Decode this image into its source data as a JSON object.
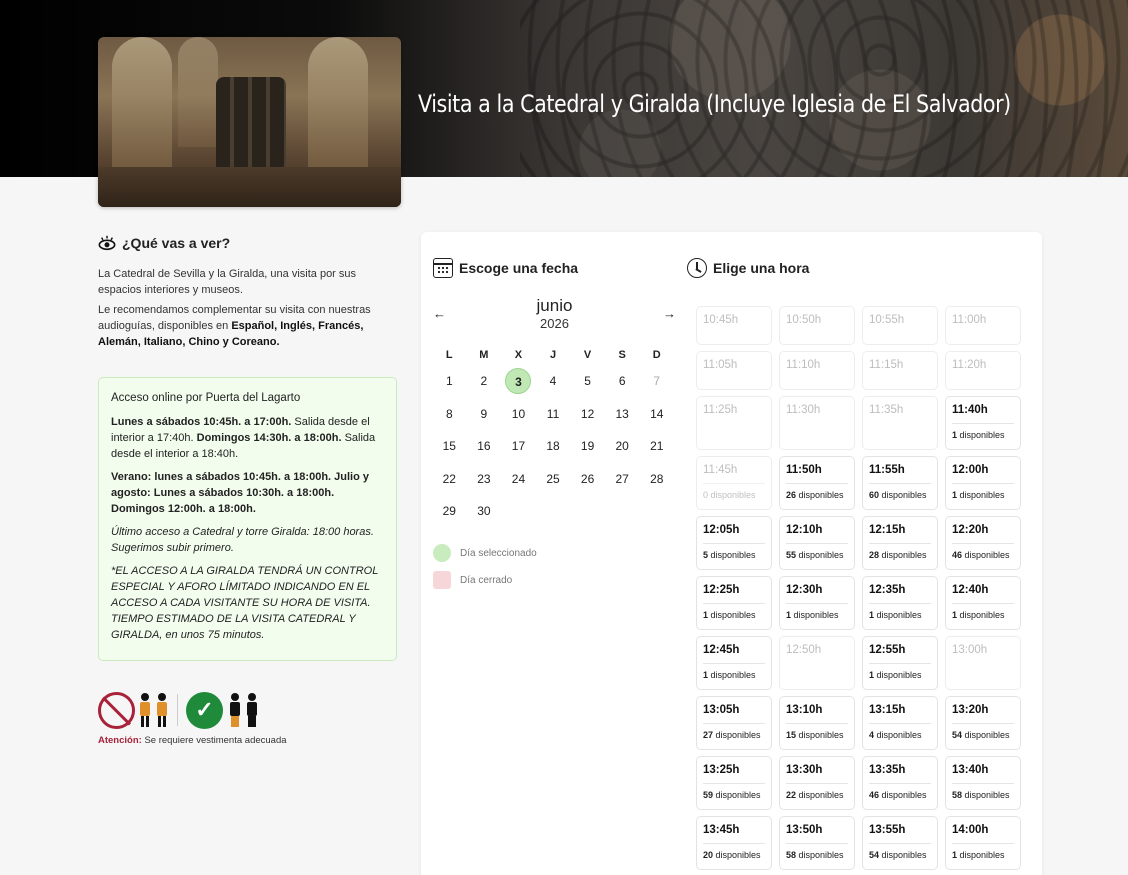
{
  "hero": {
    "title": "Visita a la Catedral y Giralda (Incluye Iglesia de El Salvador)"
  },
  "what_you_see": {
    "heading": "¿Qué vas a ver?",
    "p1": "La Catedral de Sevilla y la Giralda, una visita por sus espacios interiores y museos.",
    "p2_prefix": "Le recomendamos complementar su visita con nuestras audioguías, disponibles en ",
    "p2_langs": "Español, Inglés, Francés, Alemán, Italiano, Chino y Coreano."
  },
  "info_box": {
    "title": "Acceso online por Puerta del Lagarto",
    "hours_a": "Lunes a sábados  10:45h. a 17:00h.",
    "hours_a_rest": " Salida desde el interior a 17:40h. ",
    "hours_b": "Domingos  14:30h. a 18:00h.",
    "hours_b_rest": " Salida desde el interior a 18:40h.",
    "summer": "Verano: lunes a sábados 10:45h. a 18:00h. Julio y agosto: Lunes a sábados 10:30h. a 18:00h. Domingos 12:00h. a 18:00h.",
    "last_access": "Último acceso a Catedral y torre Giralda: 18:00 horas. Sugerimos subir primero.",
    "notice": "*EL ACCESO A LA GIRALDA TENDRÁ UN CONTROL ESPECIAL Y AFORO LÍMITADO INDICANDO EN EL ACCESO A CADA VISITANTE SU HORA DE VISITA. TIEMPO ESTIMADO DE LA VISITA CATEDRAL Y GIRALDA, en unos 75 minutos."
  },
  "dress": {
    "label": "Atención:",
    "text": " Se requiere vestimenta adecuada"
  },
  "date_section": {
    "heading": "Escoge una fecha",
    "month": "junio",
    "year": "2026",
    "prev": "←",
    "next": "→",
    "weekdays": [
      "L",
      "M",
      "X",
      "J",
      "V",
      "S",
      "D"
    ],
    "weeks": [
      [
        "1",
        "2",
        "3",
        "4",
        "5",
        "6",
        "7"
      ],
      [
        "8",
        "9",
        "10",
        "11",
        "12",
        "13",
        "14"
      ],
      [
        "15",
        "16",
        "17",
        "18",
        "19",
        "20",
        "21"
      ],
      [
        "22",
        "23",
        "24",
        "25",
        "26",
        "27",
        "28"
      ],
      [
        "29",
        "30",
        "",
        "",
        "",
        "",
        ""
      ]
    ],
    "selected": "3",
    "disabled": [
      "7"
    ],
    "legend_selected": "Día seleccionado",
    "legend_closed": "Día cerrado"
  },
  "time_section": {
    "heading": "Elige una hora",
    "unit": "disponibles",
    "slots": [
      {
        "time": "10:45h",
        "available": null
      },
      {
        "time": "10:50h",
        "available": null
      },
      {
        "time": "10:55h",
        "available": null
      },
      {
        "time": "11:00h",
        "available": null
      },
      {
        "time": "11:05h",
        "available": null
      },
      {
        "time": "11:10h",
        "available": null
      },
      {
        "time": "11:15h",
        "available": null
      },
      {
        "time": "11:20h",
        "available": null
      },
      {
        "time": "11:25h",
        "available": null
      },
      {
        "time": "11:30h",
        "available": null
      },
      {
        "time": "11:35h",
        "available": null
      },
      {
        "time": "11:40h",
        "available": 1
      },
      {
        "time": "11:45h",
        "available": 0
      },
      {
        "time": "11:50h",
        "available": 26
      },
      {
        "time": "11:55h",
        "available": 60
      },
      {
        "time": "12:00h",
        "available": 1
      },
      {
        "time": "12:05h",
        "available": 5
      },
      {
        "time": "12:10h",
        "available": 55
      },
      {
        "time": "12:15h",
        "available": 28
      },
      {
        "time": "12:20h",
        "available": 46
      },
      {
        "time": "12:25h",
        "available": 1
      },
      {
        "time": "12:30h",
        "available": 1
      },
      {
        "time": "12:35h",
        "available": 1
      },
      {
        "time": "12:40h",
        "available": 1
      },
      {
        "time": "12:45h",
        "available": 1
      },
      {
        "time": "12:50h",
        "available": null
      },
      {
        "time": "12:55h",
        "available": 1
      },
      {
        "time": "13:00h",
        "available": null
      },
      {
        "time": "13:05h",
        "available": 27
      },
      {
        "time": "13:10h",
        "available": 15
      },
      {
        "time": "13:15h",
        "available": 4
      },
      {
        "time": "13:20h",
        "available": 54
      },
      {
        "time": "13:25h",
        "available": 59
      },
      {
        "time": "13:30h",
        "available": 22
      },
      {
        "time": "13:35h",
        "available": 46
      },
      {
        "time": "13:40h",
        "available": 58
      },
      {
        "time": "13:45h",
        "available": 20
      },
      {
        "time": "13:50h",
        "available": 58
      },
      {
        "time": "13:55h",
        "available": 54
      },
      {
        "time": "14:00h",
        "available": 1
      }
    ]
  },
  "colors": {
    "selected": "#bfe8b4",
    "closed": "#f7d6d9",
    "attention": "#a8223a",
    "ok": "#1f8a3a"
  }
}
